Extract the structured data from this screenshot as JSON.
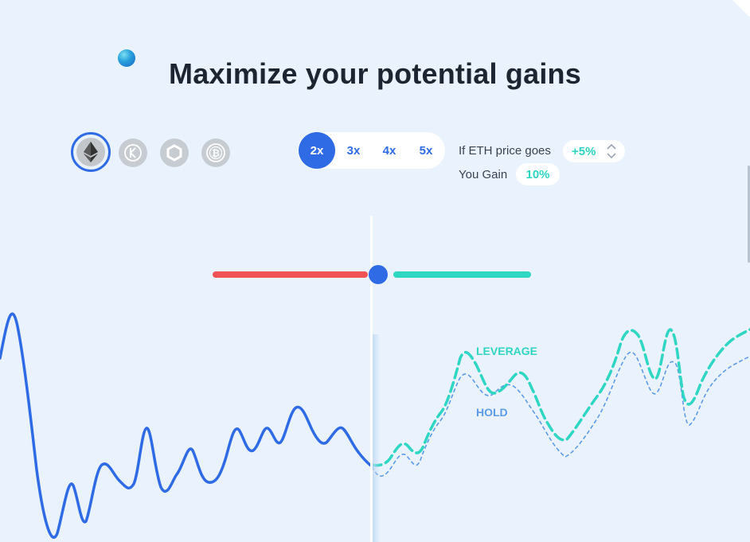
{
  "title": "Maximize your potential gains",
  "coins": [
    {
      "name": "ethereum",
      "icon": "eth-icon",
      "active": true
    },
    {
      "name": "kyber",
      "icon": "kyber-icon",
      "active": false
    },
    {
      "name": "chainlink",
      "icon": "chainlink-icon",
      "active": false
    },
    {
      "name": "bitcoin",
      "icon": "bitcoin-icon",
      "active": false
    }
  ],
  "leverage": {
    "options": [
      "2x",
      "3x",
      "4x",
      "5x"
    ],
    "selected": "2x"
  },
  "calc": {
    "price_label": "If ETH price goes",
    "price_value": "+5%",
    "gain_label": "You Gain",
    "gain_value": "10%"
  },
  "slider": {
    "position_percent": 49
  },
  "legend": {
    "leverage_label": "LEVERAGE",
    "hold_label": "HOLD"
  },
  "colors": {
    "accent": "#2f6be4",
    "leverage": "#2ed6c3",
    "hold": "#5b9be8",
    "negative": "#ef5353"
  }
}
